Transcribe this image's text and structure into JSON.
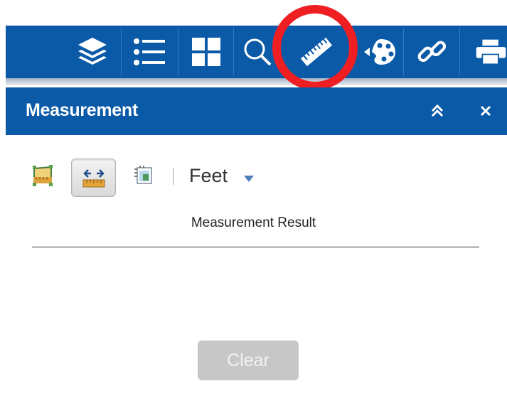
{
  "toolbar": {
    "tools": [
      {
        "icon": "layers-icon"
      },
      {
        "icon": "legend-list-icon"
      },
      {
        "icon": "basemap-gallery-icon"
      },
      {
        "icon": "search-icon"
      },
      {
        "icon": "ruler-icon",
        "highlighted": true
      },
      {
        "icon": "palette-draw-icon"
      },
      {
        "icon": "link-icon"
      },
      {
        "icon": "print-icon"
      }
    ],
    "highlight_color": "#ef1e22",
    "bar_color": "#0a5aa8"
  },
  "panel": {
    "title": "Measurement",
    "collapse_icon": "double-chevron-up-icon",
    "close_icon": "close-icon"
  },
  "measure": {
    "tools": [
      {
        "icon": "area-measure-icon",
        "active": false
      },
      {
        "icon": "distance-measure-icon",
        "active": true
      },
      {
        "icon": "location-measure-icon",
        "active": false
      }
    ],
    "unit": "Feet",
    "result_title": "Measurement Result",
    "clear_label": "Clear"
  }
}
